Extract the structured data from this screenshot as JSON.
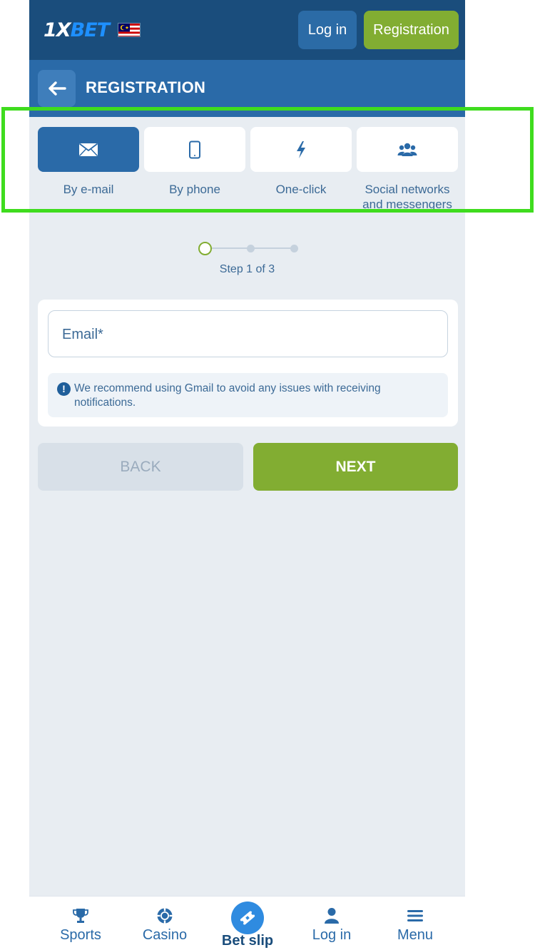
{
  "header": {
    "logo_main": "1X",
    "logo_accent": "BET",
    "login_label": "Log in",
    "registration_label": "Registration"
  },
  "subheader": {
    "title": "REGISTRATION"
  },
  "tabs": [
    {
      "label": "By e-mail",
      "icon": "envelope-icon",
      "active": true
    },
    {
      "label": "By phone",
      "icon": "phone-icon",
      "active": false
    },
    {
      "label": "One-click",
      "icon": "lightning-icon",
      "active": false
    },
    {
      "label_line1": "Social networks",
      "label_line2": "and messengers",
      "icon": "users-icon",
      "active": false
    }
  ],
  "stepper": {
    "text": "Step 1 of 3",
    "current": 1,
    "total": 3
  },
  "form": {
    "email_placeholder": "Email*",
    "notice": "We recommend using Gmail to avoid any issues with receiving notifications.",
    "notice_icon": "!"
  },
  "actions": {
    "back_label": "BACK",
    "next_label": "NEXT"
  },
  "bottom_nav": [
    {
      "label": "Sports",
      "icon": "trophy-icon"
    },
    {
      "label": "Casino",
      "icon": "casino-chip-icon"
    },
    {
      "label": "Bet slip",
      "icon": "ticket-icon"
    },
    {
      "label": "Log in",
      "icon": "user-icon"
    },
    {
      "label": "Menu",
      "icon": "hamburger-icon"
    }
  ],
  "colors": {
    "header_bg": "#1a4d7c",
    "subheader_bg": "#2a6aa8",
    "accent_green": "#82ad32",
    "page_bg": "#e8edf2",
    "highlight": "#3fdc1e"
  }
}
